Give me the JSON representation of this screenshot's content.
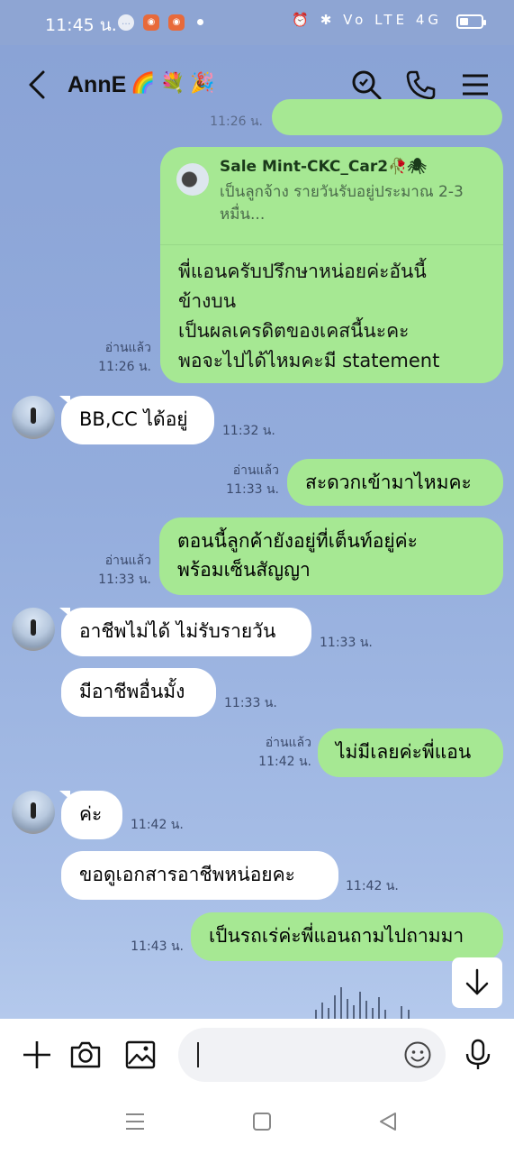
{
  "status_bar": {
    "time": "11:45 น.",
    "right_glyphs": "⏰ ✱ Vo LTE 4G",
    "battery_icon": "battery-icon"
  },
  "header": {
    "back_icon": "chevron-left-icon",
    "title": "AnnE",
    "emojis": [
      "🌈",
      "💐",
      "🎉"
    ],
    "search_icon": "search-icon",
    "call_icon": "phone-icon",
    "menu_icon": "menu-icon"
  },
  "messages": {
    "top_partial_time": "11:26 น.",
    "m1": {
      "reply_to_name": "Sale Mint-CKC_Car2",
      "reply_to_emojis": "🥀🕷",
      "reply_to_text": "เป็นลูกจ้าง รายวันรับอยู่ประมาณ 2-3 หมื่น...",
      "text_lines": [
        "พี่แอนครับปรึกษาหน่อยค่ะอันนี้",
        "ข้างบน",
        "เป็นผลเครดิตของเคสนี้นะคะ",
        "พอจะไปได้ไหมคะมี statement"
      ],
      "read": "อ่านแล้ว",
      "time": "11:26 น."
    },
    "m2": {
      "text": "BB,CC ได้อยู่",
      "time": "11:32 น."
    },
    "m3": {
      "text": "สะดวกเข้ามาไหมคะ",
      "read": "อ่านแล้ว",
      "time": "11:33 น."
    },
    "m4": {
      "text_lines": [
        "ตอนนี้ลูกค้ายังอยู่ที่เต็นท์อยู่ค่ะ",
        "พร้อมเซ็นสัญญา"
      ],
      "read": "อ่านแล้ว",
      "time": "11:33 น."
    },
    "m5": {
      "text": "อาชีพไม่ได้ ไม่รับรายวัน",
      "time": "11:33 น."
    },
    "m6": {
      "text": "มีอาชีพอื่นมั้ง",
      "time": "11:33 น."
    },
    "m7": {
      "text": "ไม่มีเลยค่ะพี่แอน",
      "read": "อ่านแล้ว",
      "time": "11:42 น."
    },
    "m8": {
      "text": "ค่ะ",
      "time": "11:42 น."
    },
    "m9": {
      "text": "ขอดูเอกสารอาชีพหน่อยคะ",
      "time": "11:42 น."
    },
    "m10": {
      "text": "เป็นรถเร่ค่ะพี่แอนถามไปถามมา",
      "time": "11:43 น."
    }
  },
  "scroll_down_icon": "arrow-down-icon",
  "input_bar": {
    "plus_icon": "plus-icon",
    "camera_icon": "camera-icon",
    "image_icon": "image-icon",
    "input_value": "",
    "emoji_icon": "emoji-icon",
    "mic_icon": "mic-icon"
  },
  "nav_bar": {
    "recent_icon": "menu-lines-icon",
    "home_icon": "square-icon",
    "back_icon": "triangle-back-icon"
  },
  "colors": {
    "chat_bg": "#8aa3d6",
    "bubble_outgoing": "#a6e893",
    "bubble_incoming": "#ffffff"
  }
}
